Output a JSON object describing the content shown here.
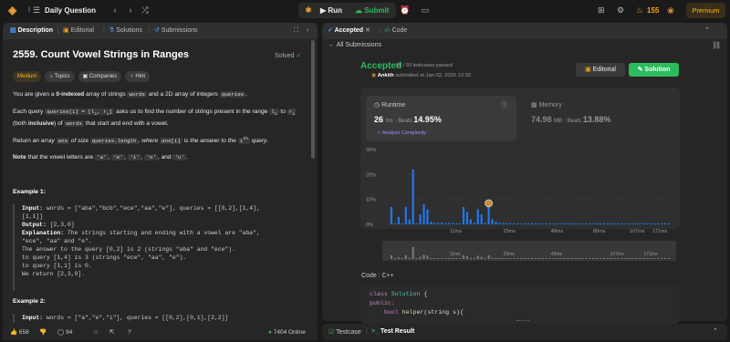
{
  "topbar": {
    "title": "Daily Question",
    "run": "Run",
    "submit": "Submit",
    "streak": "155",
    "premium": "Premium"
  },
  "left_tabs": [
    "Description",
    "Editorial",
    "Solutions",
    "Submissions"
  ],
  "problem": {
    "title": "2559. Count Vowel Strings in Ranges",
    "status": "Solved",
    "difficulty": "Medium",
    "tags": [
      "Topics",
      "Companies",
      "Hint"
    ],
    "p1_a": "You are given a ",
    "p1_b": "0-indexed",
    "p1_c": " array of strings ",
    "p1_d": "words",
    "p1_e": " and a 2D array of integers ",
    "p1_f": "queries",
    "p1_g": ".",
    "p2_a": "Each query ",
    "p2_b": "queries[i] = [l",
    "p2_b2": "i",
    "p2_b3": ", r",
    "p2_b4": "i",
    "p2_b5": "]",
    "p2_c": " asks us to find the number of strings present in the range ",
    "p2_d": "l",
    "p2_d2": "i",
    "p2_e": " to ",
    "p2_f": "r",
    "p2_f2": "i",
    "p2_g": " (both ",
    "p2_h": "inclusive",
    "p2_i": ") of ",
    "p2_j": "words",
    "p2_k": " that start and end with a vowel.",
    "p3_a": "Return ",
    "p3_b": "an array ",
    "p3_c": "ans",
    "p3_d": " of size ",
    "p3_e": "queries.length",
    "p3_f": ", where ",
    "p3_g": "ans[i]",
    "p3_h": " is the answer to the ",
    "p3_i": "i",
    "p3_j": "th",
    "p3_k": " query",
    "p3_l": ".",
    "p4_a": "Note",
    "p4_b": " that the vowel letters are ",
    "vowels": [
      "'a'",
      "'e'",
      "'i'",
      "'o'",
      "'u'"
    ],
    "p4_and": "and",
    "ex1_title": "Example 1:",
    "ex1_input_label": "Input:",
    "ex1_input": " words = [\"aba\",\"bcb\",\"ece\",\"aa\",\"e\"], queries = [[0,2],[1,4],",
    "ex1_input2": "[1,1]]",
    "ex1_output_label": "Output:",
    "ex1_output": " [2,3,0]",
    "ex1_expl_label": "Explanation:",
    "ex1_expl": " The strings starting and ending with a vowel are \"aba\",",
    "ex1_l2": "\"ece\", \"aa\" and \"e\".",
    "ex1_l3": "The answer to the query [0,2] is 2 (strings \"aba\" and \"ece\").",
    "ex1_l4": "to query [1,4] is 3 (strings \"ece\", \"aa\", \"e\").",
    "ex1_l5": "to query [1,1] is 0.",
    "ex1_l6": "We return [2,3,0].",
    "ex2_title": "Example 2:",
    "ex2_input_label": "Input:",
    "ex2_input": " words = [\"a\",\"e\",\"i\"], queries = [[0,2],[0,1],[2,2]]"
  },
  "left_footer": {
    "likes": "658",
    "comments": "94",
    "online": "7404 Online"
  },
  "right_tabs": [
    "Accepted",
    "Code"
  ],
  "all_submissions": "All Submissions",
  "result": {
    "status": "Accepted",
    "passed": "93 / 93 testcases passed",
    "author": "Ankith",
    "submitted": "submitted at Jan 02, 2025 12:32",
    "editorial": "Editorial",
    "solution": "Solution"
  },
  "runtime": {
    "label": "Runtime",
    "value": "26",
    "unit": "ms",
    "beats_label": "Beats",
    "beats": "14.95%",
    "analyze": "Analyze Complexity"
  },
  "memory": {
    "label": "Memory",
    "value": "74.98",
    "unit": "MB",
    "beats_label": "Beats",
    "beats": "13.88%"
  },
  "colors": {
    "accent_green": "#2cbb5d",
    "bar_blue": "#1d79f2",
    "medium_yellow": "#ffb800"
  },
  "chart_data": {
    "type": "bar",
    "y_ticks": [
      "30%",
      "20%",
      "10%",
      "0%"
    ],
    "ylim": [
      0,
      30
    ],
    "x_ticks": [
      "11ms",
      "23ms",
      "48ms",
      "80ms",
      "107ms",
      "171ms"
    ],
    "nav_ticks": [
      "11ms",
      "23ms",
      "45ms",
      "107ms",
      "171ms"
    ],
    "values": [
      7,
      0.4,
      3,
      0.4,
      7,
      2,
      22,
      0.4,
      4,
      8,
      6,
      1,
      0.6,
      0.6,
      0.6,
      0.5,
      0.5,
      0.5,
      0.4,
      0.4,
      7,
      5,
      2,
      0.6,
      6,
      4,
      0.6,
      7,
      2,
      1,
      0.6,
      0.5,
      0.5,
      0.5,
      0.4,
      0.4,
      0.4,
      0.4,
      0.4,
      0.4,
      0.4,
      0.4,
      0.4,
      0.4,
      0.4,
      0.4,
      0.4,
      0.4,
      0.4,
      0.4,
      0.4,
      0.4,
      0.4,
      0.4,
      0.4,
      0.4,
      0.4,
      0.4,
      0.4,
      0.4,
      0.4,
      0.4,
      0.4,
      0.4,
      0.4,
      0.4,
      0.4,
      0.4,
      0.4,
      0.4,
      0.4,
      0.4,
      0.4,
      0.4,
      0.4,
      0.4,
      0.4,
      0.4
    ],
    "highlight_index": 27
  },
  "code": {
    "label": "Code",
    "lang": "C++",
    "l1_kw": "class",
    "l1_ty": "Solution",
    "l1_rest": " {",
    "l2": "public:",
    "l3_kw": "bool",
    "l3_fn": "helper",
    "l3_rest": "(string s){"
  },
  "bottom": {
    "testcase": "Testcase",
    "test_result": "Test Result"
  }
}
